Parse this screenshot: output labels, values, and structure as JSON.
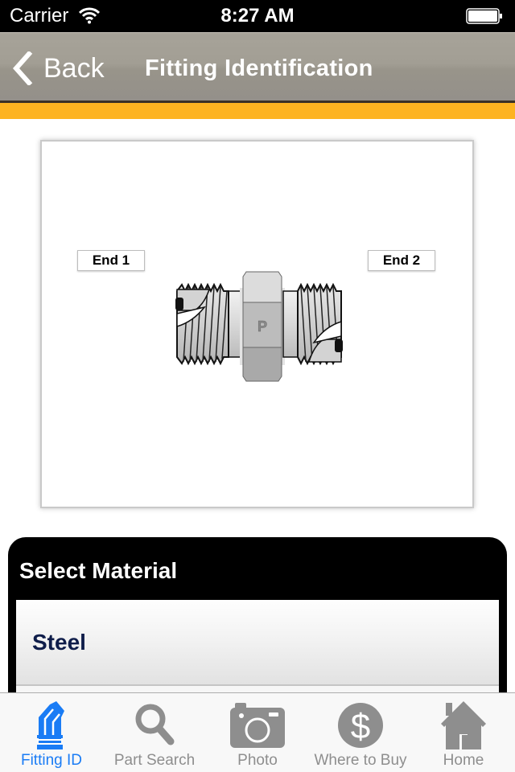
{
  "status_bar": {
    "carrier": "Carrier",
    "time": "8:27 AM",
    "wifi_icon": "wifi-icon",
    "battery_icon": "battery-full-icon"
  },
  "nav": {
    "back_label": "Back",
    "back_icon": "chevron-left-icon",
    "title": "Fitting Identification"
  },
  "colors": {
    "accent": "#fdb320",
    "nav_bar": "#a29e94",
    "tab_active": "#1a7cf5",
    "tab_inactive": "#8e8e8e",
    "material_text": "#0f1d4a"
  },
  "fitting_image": {
    "end_labels": [
      "End 1",
      "End 2"
    ],
    "hex_marking": "P",
    "description": "straight thread fitting with hex"
  },
  "material_panel": {
    "title": "Select Material",
    "items": [
      {
        "label": "Steel"
      }
    ]
  },
  "tab_bar": {
    "tabs": [
      {
        "label": "Fitting ID",
        "icon": "fitting-id-icon",
        "active": true
      },
      {
        "label": "Part Search",
        "icon": "search-icon",
        "active": false
      },
      {
        "label": "Photo",
        "icon": "camera-icon",
        "active": false
      },
      {
        "label": "Where to Buy",
        "icon": "dollar-icon",
        "active": false
      },
      {
        "label": "Home",
        "icon": "home-icon",
        "active": false
      }
    ]
  }
}
